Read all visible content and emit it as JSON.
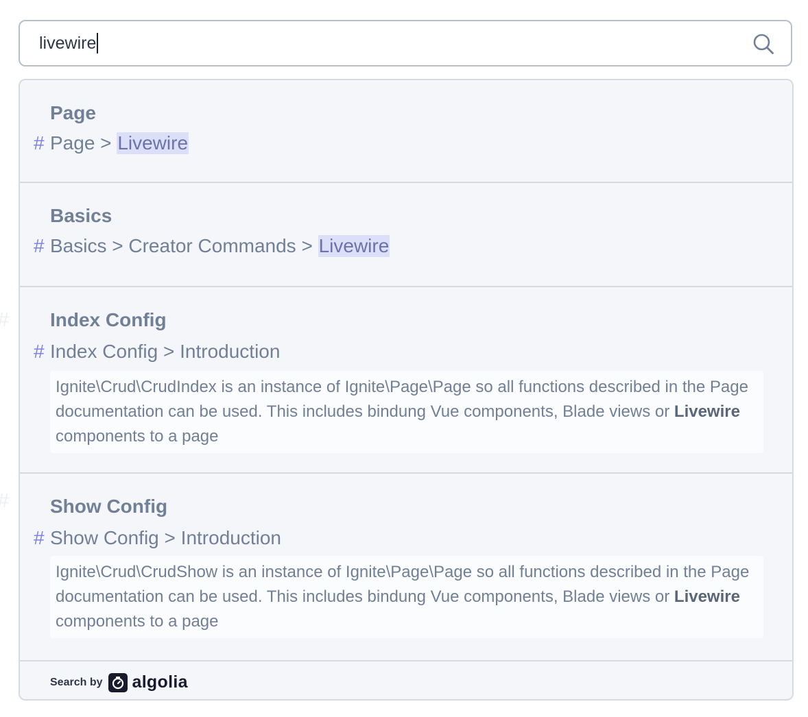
{
  "search": {
    "value": "livewire"
  },
  "results": [
    {
      "category": "Page",
      "hierarchy_prefix": "Page > ",
      "hierarchy_match": "Livewire"
    },
    {
      "category": "Basics",
      "hierarchy_prefix": "Basics > Creator Commands > ",
      "hierarchy_match": "Livewire"
    },
    {
      "category": "Index Config",
      "hierarchy": "Index Config > Introduction",
      "snippet_before": "Ignite\\Crud\\CrudIndex is an instance of Ignite\\Page\\Page so all functions described in the Page documentation can be used. This includes bindung Vue components, Blade views or ",
      "snippet_match": "Livewire",
      "snippet_after": " components to a page"
    },
    {
      "category": "Show Config",
      "hierarchy": "Show Config > Introduction",
      "snippet_before": "Ignite\\Crud\\CrudShow is an instance of Ignite\\Page\\Page so all functions described in the Page documentation can be used. This includes bindung Vue components, Blade views or ",
      "snippet_match": "Livewire",
      "snippet_after": " components to a page"
    }
  ],
  "hash_symbol": "#",
  "footer": {
    "search_by": "Search by",
    "brand": "algolia"
  },
  "colors": {
    "highlight": "#dcdff8",
    "hash": "#7c83e0",
    "text": "#718096"
  }
}
